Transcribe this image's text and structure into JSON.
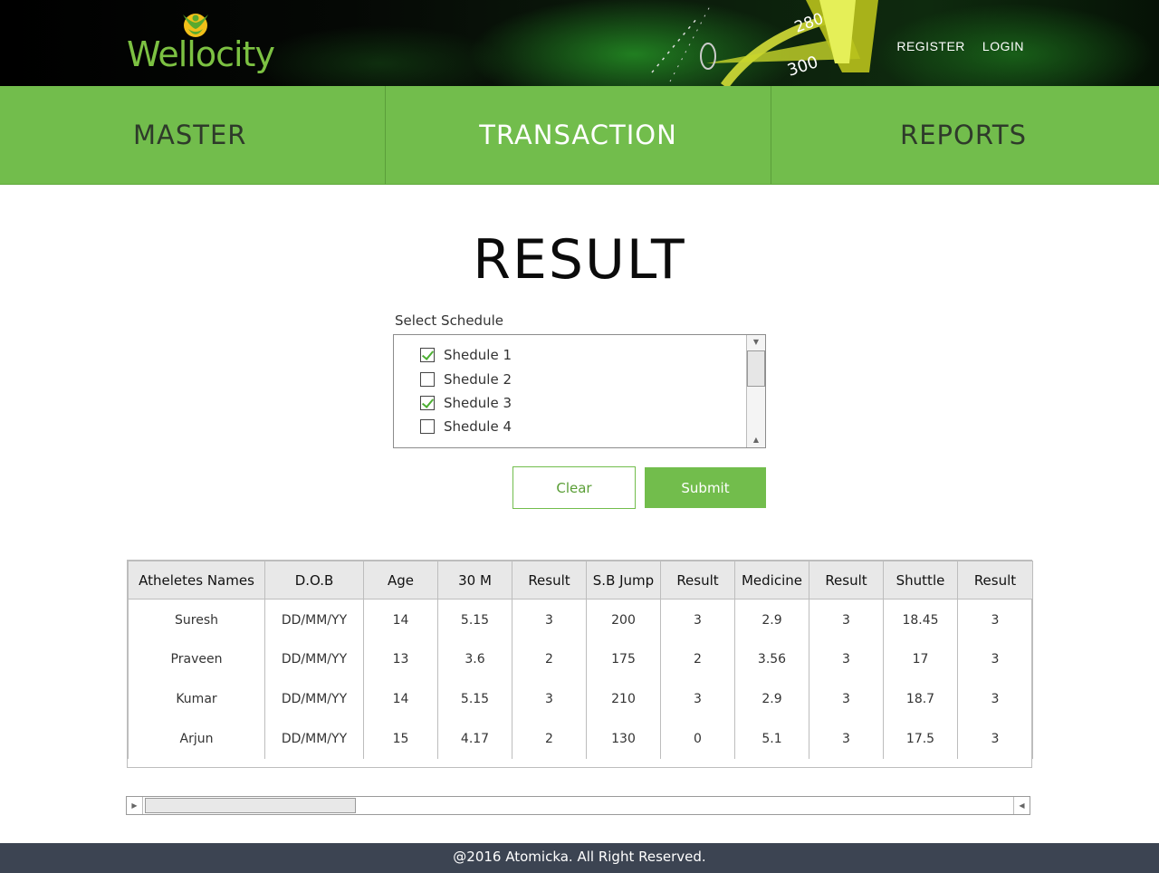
{
  "brand": {
    "name": "Wellocity",
    "logo_color": "#7cc142"
  },
  "header": {
    "speedometer_marks": [
      "280",
      "300"
    ],
    "links": {
      "register": "REGISTER",
      "login": "LOGIN"
    }
  },
  "nav": {
    "items": [
      {
        "label": "MASTER",
        "active": false
      },
      {
        "label": "TRANSACTION",
        "active": true
      },
      {
        "label": "REPORTS",
        "active": false
      }
    ],
    "bg_color": "#72bd4c"
  },
  "page": {
    "title": "RESULT"
  },
  "schedule": {
    "label": "Select Schedule",
    "options": [
      {
        "label": "Shedule 1",
        "checked": true
      },
      {
        "label": "Shedule 2",
        "checked": false
      },
      {
        "label": "Shedule 3",
        "checked": true
      },
      {
        "label": "Shedule 4",
        "checked": false
      }
    ]
  },
  "actions": {
    "clear": "Clear",
    "submit": "Submit"
  },
  "table": {
    "headers": [
      "Atheletes Names",
      "D.O.B",
      "Age",
      "30 M",
      "Result",
      "S.B Jump",
      "Result",
      "Medicine",
      "Result",
      "Shuttle",
      "Result"
    ],
    "rows": [
      [
        "Suresh",
        "DD/MM/YY",
        "14",
        "5.15",
        "3",
        "200",
        "3",
        "2.9",
        "3",
        "18.45",
        "3"
      ],
      [
        "Praveen",
        "DD/MM/YY",
        "13",
        "3.6",
        "2",
        "175",
        "2",
        "3.56",
        "3",
        "17",
        "3"
      ],
      [
        "Kumar",
        "DD/MM/YY",
        "14",
        "5.15",
        "3",
        "210",
        "3",
        "2.9",
        "3",
        "18.7",
        "3"
      ],
      [
        "Arjun",
        "DD/MM/YY",
        "15",
        "4.17",
        "2",
        "130",
        "0",
        "5.1",
        "3",
        "17.5",
        "3"
      ]
    ]
  },
  "footer": {
    "text": "@2016 Atomicka. All Right Reserved."
  }
}
